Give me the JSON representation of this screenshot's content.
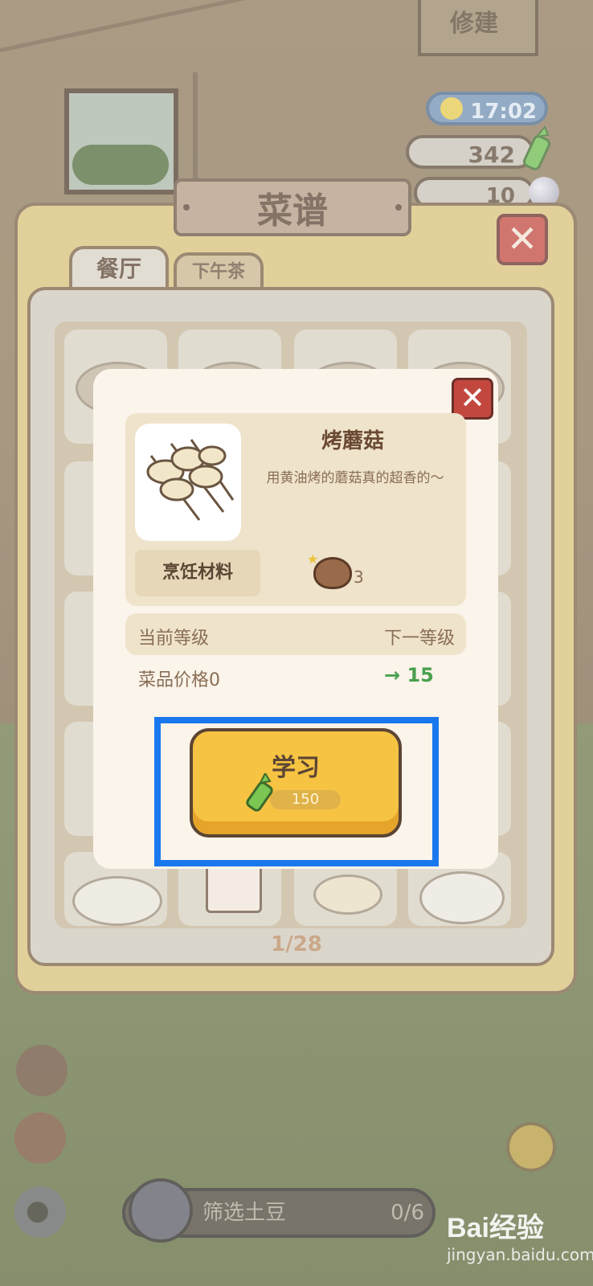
{
  "hud": {
    "time": "17:02",
    "bamboo": "342",
    "pearls": "10",
    "sign_fragment": "修建"
  },
  "panel": {
    "title": "菜谱",
    "tabs": [
      {
        "label": "餐厅",
        "active": true
      },
      {
        "label": "下午茶",
        "active": false
      }
    ],
    "pager": "1/28"
  },
  "dialog": {
    "dish_name": "烤蘑菇",
    "description": "用黄油烤的蘑菇真的超香的～",
    "ingredients_label": "烹饪材料",
    "ingredient": {
      "icon": "mushroom-icon",
      "count": "3"
    },
    "current_level_label": "当前等级",
    "next_level_label": "下一等级",
    "price_label": "菜品价格0",
    "price_next": "15",
    "learn_button": {
      "label": "学习",
      "cost": "150"
    }
  },
  "bottom": {
    "filter_label": "筛选土豆",
    "filter_count": "0/6"
  },
  "watermark": {
    "main": "Bai经验",
    "sub": "jingyan.baidu.com"
  },
  "colors": {
    "accent_blue": "#1a78ee",
    "button_yellow": "#f6c343",
    "close_red": "#c2483f",
    "price_green": "#4aa04e"
  }
}
